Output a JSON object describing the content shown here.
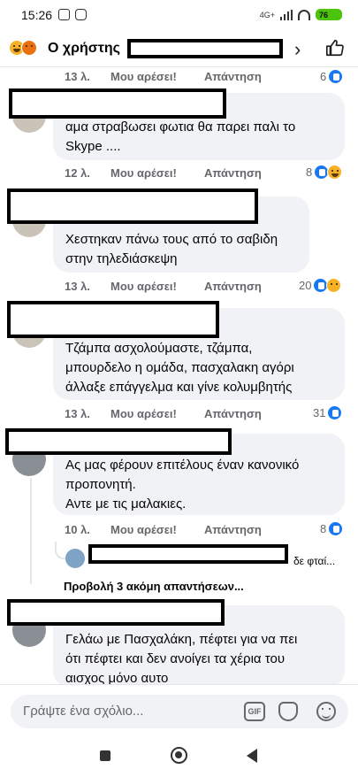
{
  "status_bar": {
    "time": "15:26",
    "network_label": "4G+",
    "battery_label": "76"
  },
  "header": {
    "title_prefix": "Ο χρήστης",
    "chevron": "›"
  },
  "comments": [
    {
      "text_lines": [],
      "time": "13 λ.",
      "like_label": "Μου αρέσει!",
      "reply_label": "Απάντηση",
      "reaction_count": "6",
      "reaction_icons": [
        "like-icon"
      ]
    },
    {
      "text_lines": [
        "αμα στραβωσει φωτια θα παρει παλι το",
        "Skype ...."
      ],
      "time": "12 λ.",
      "like_label": "Μου αρέσει!",
      "reply_label": "Απάντηση",
      "reaction_count": "8",
      "reaction_icons": [
        "like-icon",
        "haha-icon"
      ]
    },
    {
      "text_lines": [
        "Χεστηκαν πάνω τους από το σαβιδη",
        "στην τηλεδιάσκεψη"
      ],
      "time": "13 λ.",
      "like_label": "Μου αρέσει!",
      "reply_label": "Απάντηση",
      "reaction_count": "20",
      "reaction_icons": [
        "like-icon",
        "sad-icon"
      ]
    },
    {
      "text_lines": [
        "Τζάμπα ασχολούμαστε, τζάμπα,",
        "μπουρδελο η ομάδα, πασχαλακη αγόρι",
        "άλλαξε επάγγελμα και γίνε κολυμβητής"
      ],
      "time": "13 λ.",
      "like_label": "Μου αρέσει!",
      "reply_label": "Απάντηση",
      "reaction_count": "31",
      "reaction_icons": [
        "like-icon"
      ]
    },
    {
      "text_lines": [
        "Ας μας φέρουν επιτέλους έναν κανονικό",
        "προπονητή.",
        "Αντε με τις μαλακιες."
      ],
      "time": "10 λ.",
      "like_label": "Μου αρέσει!",
      "reply_label": "Απάντηση",
      "reaction_count": "8",
      "reaction_icons": [
        "like-icon"
      ],
      "reply_preview": "δε φταί...",
      "more_replies": "Προβολή 3 ακόμη απαντήσεων..."
    },
    {
      "text_lines": [
        "Γελάω με Πασχαλάκη, πέφτει για να πει",
        "ότι πέφτει και δεν ανοίγει τα χέρια του",
        "αισχος μόνο αυτο"
      ]
    }
  ],
  "composer": {
    "placeholder": "Γράψτε ένα σχόλιο...",
    "gif_label": "GIF"
  },
  "colors": {
    "bubble": "#f0f2f5",
    "meta_text": "#65676b",
    "like_blue": "#1877f2",
    "emoji_yellow": "#f7b125"
  }
}
